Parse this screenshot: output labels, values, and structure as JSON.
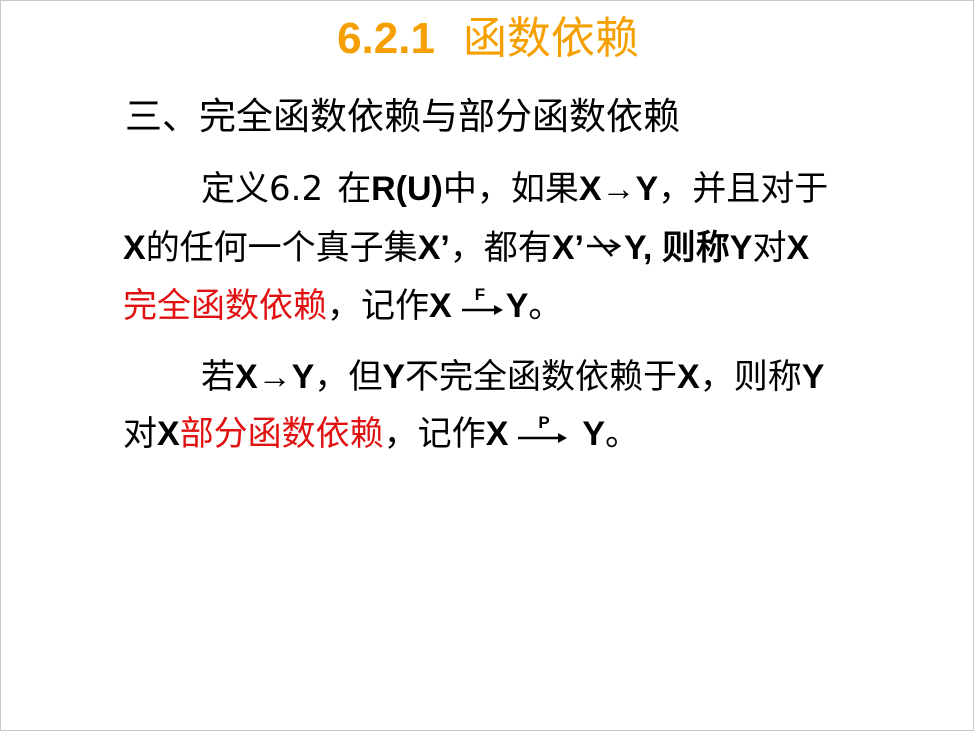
{
  "slide": {
    "title_number": "6.2.1",
    "title_text": "函数依赖",
    "heading": "三、完全函数依赖与部分函数依赖",
    "def_label": "定义6.2",
    "def_t1": "在",
    "def_b1": "R(U)",
    "def_t2": "中，如果",
    "def_b2": "X→Y",
    "def_t3": "，并且对于",
    "l2_b1": "X",
    "l2_t1": "的任何一个真子集",
    "l2_b2": "X’",
    "l2_t2": "，都有",
    "l2_b3": "X’",
    "l2_b4": "Y",
    "l2_t3": ", 则称",
    "l2_b5": "Y",
    "l2_t4": "对",
    "l2_b6": "X",
    "l3_red": "完全函数依赖",
    "l3_t1": "，记作",
    "l3_b1": "X",
    "l3_arrow_label": "F",
    "l3_b2": "Y",
    "l3_t2": "。",
    "p2_t1": "若",
    "p2_b1": "X→Y",
    "p2_t2": "，但",
    "p2_b2": "Y",
    "p2_t3": "不完全函数依赖于",
    "p2_b3": "X",
    "p2_t4": "，则称",
    "p2_b4": "Y",
    "l5_t1": "对",
    "l5_b1": "X",
    "l5_red": "部分函数依赖",
    "l5_t2": "，记作",
    "l5_b2": "X",
    "l5_arrow_label": "P",
    "l5_b3": "Y",
    "l5_t3": "。"
  }
}
